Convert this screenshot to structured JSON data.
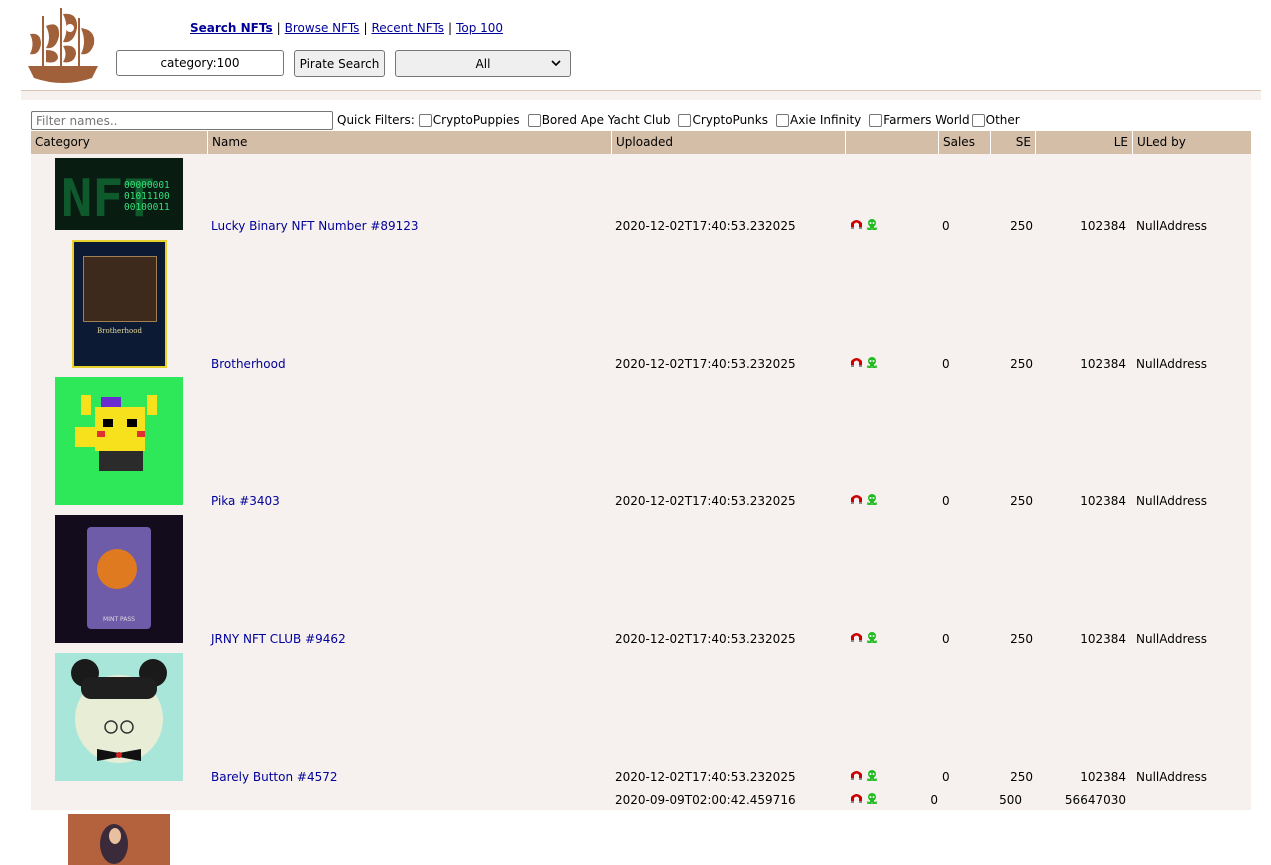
{
  "nav": {
    "links": [
      "Search NFTs",
      "Browse NFTs",
      "Recent NFTs",
      "Top 100"
    ],
    "separator": "|"
  },
  "search": {
    "value": "category:100",
    "button_label": "Pirate Search",
    "category_selected": "All"
  },
  "filters": {
    "placeholder": "Filter names..",
    "quick_label": "Quick Filters:",
    "options": [
      "CryptoPuppies",
      "Bored Ape Yacht Club",
      "CryptoPunks",
      "Axie Infinity",
      "Farmers World",
      "Other"
    ]
  },
  "table": {
    "headers": [
      "Category",
      "Name",
      "Uploaded",
      "",
      "Sales",
      "SE",
      "LE",
      "ULed by"
    ],
    "rows": [
      {
        "name": "Lucky Binary NFT Number #89123",
        "uploaded": "2020-12-02T17:40:53.232025",
        "sales": "0",
        "se": "250",
        "le": "102384",
        "uled_by": "NullAddress",
        "thumb_text": "00000001\n01011100\n00100011"
      },
      {
        "name": "Brotherhood",
        "uploaded": "2020-12-02T17:40:53.232025",
        "sales": "0",
        "se": "250",
        "le": "102384",
        "uled_by": "NullAddress",
        "thumb_text": "Brotherhood"
      },
      {
        "name": "Pika #3403",
        "uploaded": "2020-12-02T17:40:53.232025",
        "sales": "0",
        "se": "250",
        "le": "102384",
        "uled_by": "NullAddress"
      },
      {
        "name": "JRNY NFT CLUB #9462",
        "uploaded": "2020-12-02T17:40:53.232025",
        "sales": "0",
        "se": "250",
        "le": "102384",
        "uled_by": "NullAddress",
        "thumb_text": "MINT PASS"
      },
      {
        "name": "Barely Button #4572",
        "uploaded": "2020-12-02T17:40:53.232025",
        "sales": "0",
        "se": "250",
        "le": "102384",
        "uled_by": "NullAddress"
      },
      {
        "name": "",
        "uploaded": "2020-09-09T02:00:42.459716",
        "sales": "0",
        "se": "500",
        "le": "56647030",
        "uled_by": ""
      }
    ]
  },
  "colors": {
    "header_bg": "#d5bea8",
    "row_bg": "#f6f1ee",
    "link": "#000099",
    "magnet_icon": "#cc0000",
    "vip_icon": "#22bb22"
  },
  "icons": [
    "pirate-ship-logo",
    "magnet-icon",
    "skull-icon",
    "chevron-down-icon"
  ]
}
